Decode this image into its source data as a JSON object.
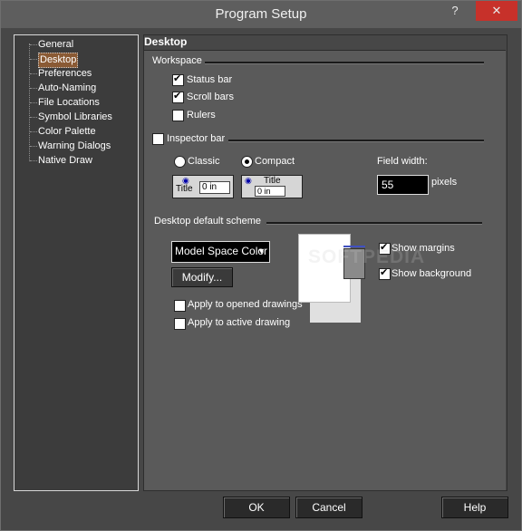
{
  "window": {
    "title": "Program Setup",
    "help_glyph": "?",
    "close_glyph": "✕"
  },
  "tree": {
    "items": [
      {
        "label": "General"
      },
      {
        "label": "Desktop",
        "selected": true
      },
      {
        "label": "Preferences"
      },
      {
        "label": "Auto-Naming"
      },
      {
        "label": "File Locations"
      },
      {
        "label": "Symbol Libraries"
      },
      {
        "label": "Color Palette"
      },
      {
        "label": "Warning Dialogs"
      },
      {
        "label": "Native Draw"
      }
    ]
  },
  "panel": {
    "title": "Desktop",
    "workspace": {
      "label": "Workspace",
      "status_bar": {
        "label": "Status bar",
        "checked": true
      },
      "scroll_bars": {
        "label": "Scroll bars",
        "checked": true
      },
      "rulers": {
        "label": "Rulers",
        "checked": false
      }
    },
    "inspector": {
      "label": "Inspector bar",
      "checked": false,
      "classic": {
        "label": "Classic",
        "selected": false
      },
      "compact": {
        "label": "Compact",
        "selected": true
      },
      "sample_title": "Title",
      "sample_value": "0 in",
      "field_width_label": "Field width:",
      "field_width_value": "55",
      "pixels_label": "pixels"
    },
    "scheme": {
      "label": "Desktop default scheme",
      "selected": "Model Space Color",
      "modify_label": "Modify...",
      "apply_opened": {
        "label": "Apply to opened drawings",
        "checked": false
      },
      "apply_active": {
        "label": "Apply to active drawing",
        "checked": false
      },
      "show_margins": {
        "label": "Show margins",
        "checked": true
      },
      "show_background": {
        "label": "Show background",
        "checked": true
      }
    }
  },
  "footer": {
    "ok": "OK",
    "cancel": "Cancel",
    "help": "Help"
  },
  "watermark": "SOFTPEDIA"
}
